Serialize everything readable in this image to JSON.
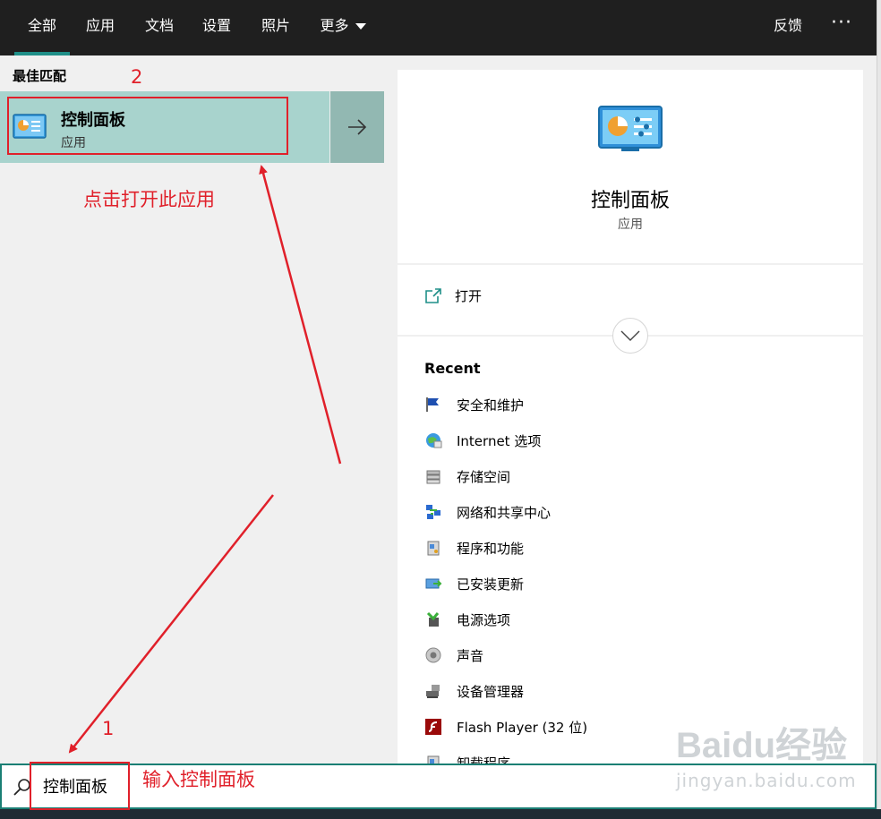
{
  "tabs": [
    {
      "label": "全部",
      "active": true
    },
    {
      "label": "应用"
    },
    {
      "label": "文档"
    },
    {
      "label": "设置"
    },
    {
      "label": "照片"
    },
    {
      "label": "更多"
    }
  ],
  "feedback": "反馈",
  "more_options": "···",
  "best_match": {
    "section_label": "最佳匹配",
    "title": "控制面板",
    "subtitle": "应用"
  },
  "detail": {
    "title": "控制面板",
    "subtitle": "应用",
    "open_label": "打开",
    "recent_title": "Recent",
    "recent_items": [
      {
        "label": "安全和维护",
        "icon": "flag-icon"
      },
      {
        "label": "Internet 选项",
        "icon": "globe-icon"
      },
      {
        "label": "存储空间",
        "icon": "storage-icon"
      },
      {
        "label": "网络和共享中心",
        "icon": "network-icon"
      },
      {
        "label": "程序和功能",
        "icon": "programs-icon"
      },
      {
        "label": "已安装更新",
        "icon": "updates-icon"
      },
      {
        "label": "电源选项",
        "icon": "power-icon"
      },
      {
        "label": "声音",
        "icon": "sound-icon"
      },
      {
        "label": "设备管理器",
        "icon": "device-manager-icon"
      },
      {
        "label": "Flash Player (32 位)",
        "icon": "flash-icon"
      },
      {
        "label": "卸载程序",
        "icon": "uninstall-icon"
      }
    ]
  },
  "search": {
    "value": "控制面板"
  },
  "annotations": {
    "step1_number": "1",
    "step2_number": "2",
    "step1_text": "输入控制面板",
    "step2_text": "点击打开此应用"
  },
  "watermark": {
    "logo": "Baidu经验",
    "url": "jingyan.baidu.com"
  },
  "colors": {
    "accent": "#1f8f88",
    "selected_bg": "#a8d3cd",
    "annotation": "#e0202a"
  }
}
